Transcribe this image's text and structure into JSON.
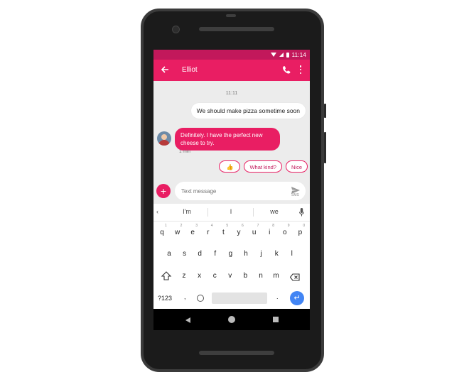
{
  "status_bar": {
    "time": "11:14"
  },
  "app_bar": {
    "contact_name": "Elliot"
  },
  "conversation": {
    "time_divider": "11:11",
    "messages": [
      {
        "direction": "outgoing",
        "text": "We should make pizza sometime soon"
      },
      {
        "direction": "incoming",
        "text": "Definitely. I have the perfect new cheese to try.",
        "meta": "1 min"
      }
    ],
    "smart_replies": [
      "👍",
      "What kind?",
      "Nice"
    ]
  },
  "compose": {
    "placeholder": "Text message",
    "send_mode": "SMS"
  },
  "keyboard": {
    "suggestions": [
      "I'm",
      "I",
      "we"
    ],
    "row1": [
      "q",
      "w",
      "e",
      "r",
      "t",
      "y",
      "u",
      "i",
      "o",
      "p"
    ],
    "row1_hints": [
      "1",
      "2",
      "3",
      "4",
      "5",
      "6",
      "7",
      "8",
      "9",
      "0"
    ],
    "row2": [
      "a",
      "s",
      "d",
      "f",
      "g",
      "h",
      "j",
      "k",
      "l"
    ],
    "row3": [
      "z",
      "x",
      "c",
      "v",
      "b",
      "n",
      "m"
    ],
    "symbols_key": "?123",
    "comma_key": ",",
    "period_key": "."
  },
  "colors": {
    "accent": "#e91e63",
    "accent_dark": "#c2185b",
    "background": "#ececec",
    "enter_key": "#4285f4"
  }
}
